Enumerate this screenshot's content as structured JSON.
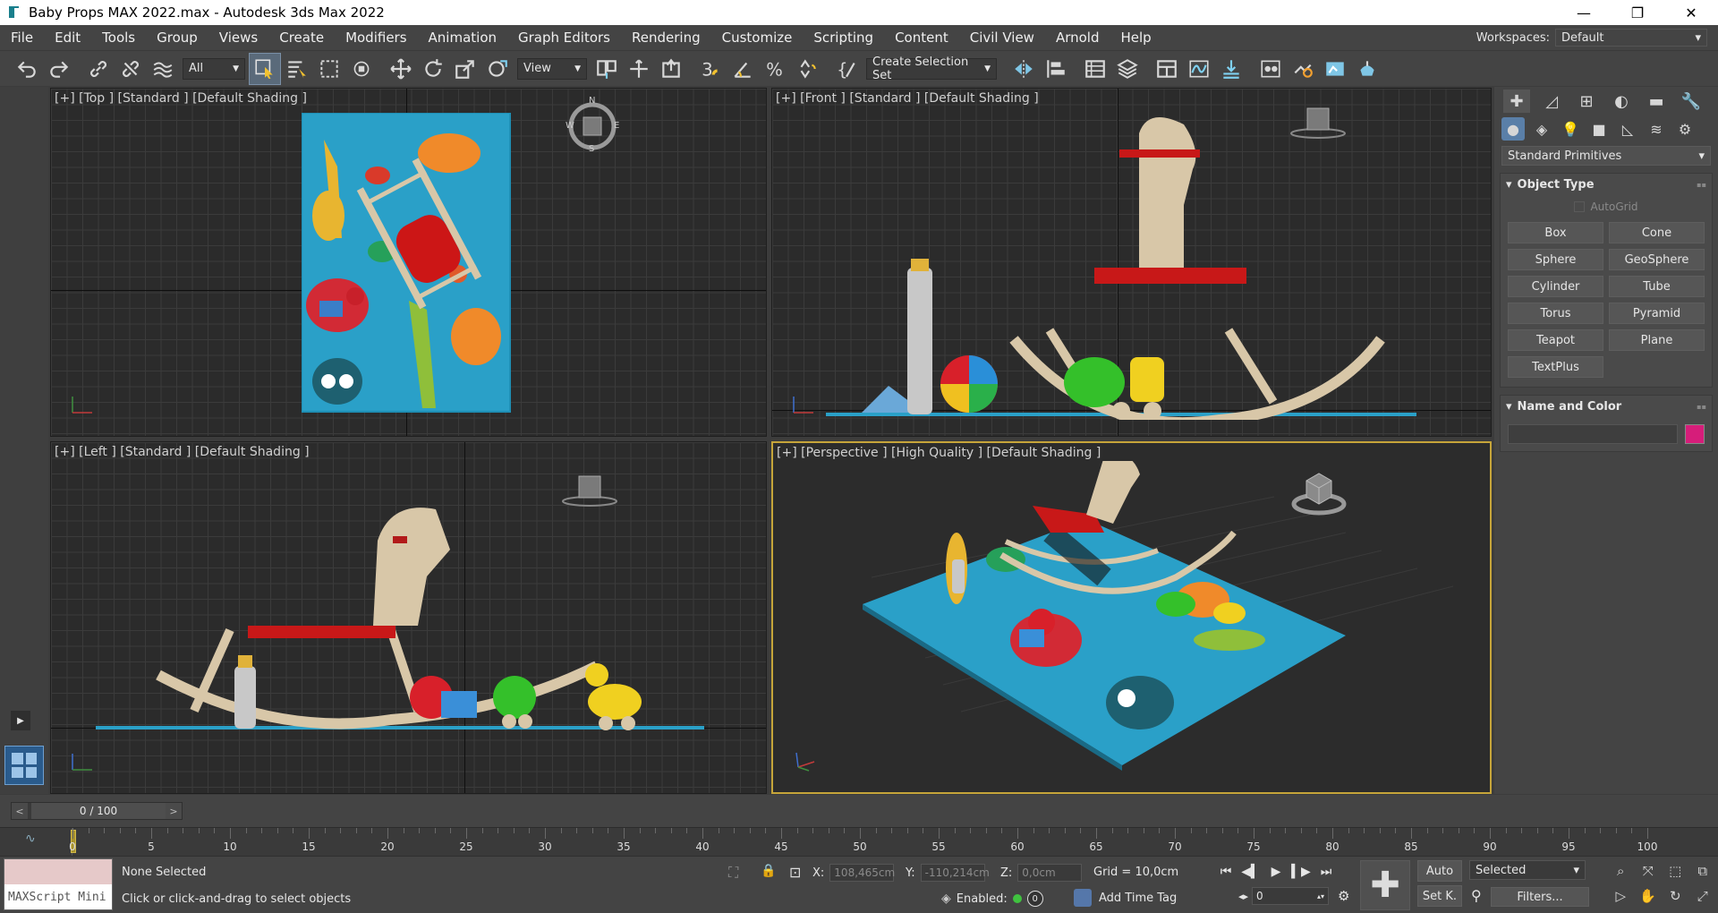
{
  "window": {
    "title": "Baby Props MAX 2022.max - Autodesk 3ds Max 2022",
    "minimize": "—",
    "restore": "❐",
    "close": "✕"
  },
  "menu": [
    "File",
    "Edit",
    "Tools",
    "Group",
    "Views",
    "Create",
    "Modifiers",
    "Animation",
    "Graph Editors",
    "Rendering",
    "Customize",
    "Scripting",
    "Content",
    "Civil View",
    "Arnold",
    "Help"
  ],
  "workspaces": {
    "label": "Workspaces:",
    "value": "Default"
  },
  "toolbar": {
    "filter": "All",
    "refcoord": "View",
    "selection_set": "Create Selection Set"
  },
  "viewports": {
    "top": "[+] [Top ] [Standard ] [Default Shading ]",
    "front": "[+] [Front ] [Standard ] [Default Shading ]",
    "left": "[+] [Left ] [Standard ] [Default Shading ]",
    "perspective": "[+] [Perspective ] [High Quality ] [Default Shading ]",
    "compass": {
      "n": "N",
      "s": "S",
      "e": "E",
      "w": "W"
    }
  },
  "command_panel": {
    "category": "Standard Primitives",
    "object_type": {
      "title": "Object Type",
      "autogrid": "AutoGrid",
      "buttons": [
        "Box",
        "Cone",
        "Sphere",
        "GeoSphere",
        "Cylinder",
        "Tube",
        "Torus",
        "Pyramid",
        "Teapot",
        "Plane",
        "TextPlus"
      ]
    },
    "name_color": {
      "title": "Name and Color",
      "swatch": "#d61d7a"
    }
  },
  "time_slider": {
    "value": "0 / 100",
    "prev": "<",
    "next": ">"
  },
  "ruler": {
    "labels": [
      "0",
      "5",
      "10",
      "15",
      "20",
      "25",
      "30",
      "35",
      "40",
      "45",
      "50",
      "55",
      "60",
      "65",
      "70",
      "75",
      "80",
      "85",
      "90",
      "95",
      "100"
    ]
  },
  "status": {
    "maxscript": "MAXScript Mini",
    "selection": "None Selected",
    "prompt": "Click or click-and-drag to select objects",
    "x_label": "X:",
    "x": "108,465cm",
    "y_label": "Y:",
    "y": "-110,214cm",
    "z_label": "Z:",
    "z": "0,0cm",
    "grid": "Grid = 10,0cm",
    "enabled": "Enabled:",
    "enabled_count": "0",
    "add_time_tag": "Add Time Tag",
    "frame": "0",
    "auto": "Auto",
    "setk": "Set K.",
    "selected": "Selected",
    "filters": "Filters..."
  }
}
